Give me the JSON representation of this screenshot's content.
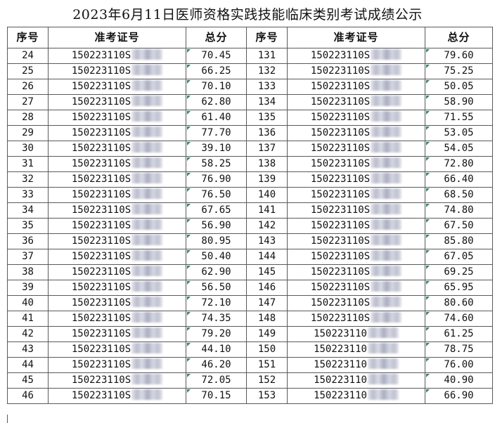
{
  "title": "2023年6月11日医师资格实践技能临床类别考试成绩公示",
  "headers": [
    "序号",
    "准考证号",
    "总分",
    "序号",
    "准考证号",
    "总分"
  ],
  "rows": [
    [
      "24",
      "150223110S",
      "70.45",
      "131",
      "150223110S",
      "79.60"
    ],
    [
      "25",
      "150223110S",
      "66.25",
      "132",
      "150223110S",
      "75.25"
    ],
    [
      "26",
      "150223110S",
      "70.10",
      "133",
      "150223110S",
      "50.05"
    ],
    [
      "27",
      "150223110S",
      "62.80",
      "134",
      "150223110S",
      "58.90"
    ],
    [
      "28",
      "150223110S",
      "61.40",
      "135",
      "150223110S",
      "71.55"
    ],
    [
      "29",
      "150223110S",
      "77.70",
      "136",
      "150223110S",
      "53.05"
    ],
    [
      "30",
      "150223110S",
      "39.10",
      "137",
      "150223110S",
      "54.05"
    ],
    [
      "31",
      "150223110S",
      "58.25",
      "138",
      "150223110S",
      "72.80"
    ],
    [
      "32",
      "150223110S",
      "76.90",
      "139",
      "150223110S",
      "66.40"
    ],
    [
      "33",
      "150223110S",
      "76.50",
      "140",
      "150223110S",
      "68.50"
    ],
    [
      "34",
      "150223110S",
      "67.65",
      "141",
      "150223110S",
      "74.80"
    ],
    [
      "35",
      "150223110S",
      "56.90",
      "142",
      "150223110S",
      "67.50"
    ],
    [
      "36",
      "150223110S",
      "80.95",
      "143",
      "150223110S",
      "85.80"
    ],
    [
      "37",
      "150223110S",
      "50.40",
      "144",
      "150223110S",
      "67.05"
    ],
    [
      "38",
      "150223110S",
      "62.90",
      "145",
      "150223110S",
      "69.25"
    ],
    [
      "39",
      "150223110S",
      "56.50",
      "146",
      "150223110S",
      "65.95"
    ],
    [
      "40",
      "150223110S",
      "72.10",
      "147",
      "150223110S",
      "80.60"
    ],
    [
      "41",
      "150223110S",
      "74.35",
      "148",
      "150223110S",
      "74.60"
    ],
    [
      "42",
      "150223110S",
      "79.20",
      "149",
      "150223110",
      "61.25"
    ],
    [
      "43",
      "150223110S",
      "44.10",
      "150",
      "150223110",
      "78.75"
    ],
    [
      "44",
      "150223110S",
      "46.20",
      "151",
      "150223110",
      "76.00"
    ],
    [
      "45",
      "150223110S",
      "72.05",
      "152",
      "150223110",
      "40.90"
    ],
    [
      "46",
      "150223110S",
      "70.15",
      "153",
      "150223110",
      "66.90"
    ]
  ]
}
